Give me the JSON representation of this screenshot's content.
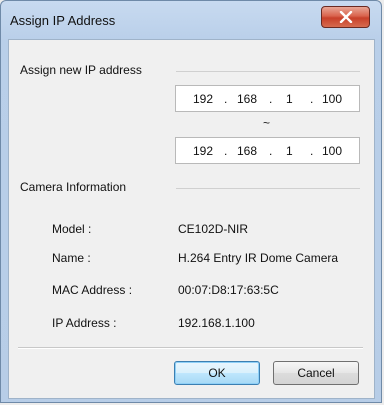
{
  "window": {
    "title": "Assign IP Address"
  },
  "assign_group": {
    "label": "Assign new IP address",
    "start_ip": [
      "192",
      "168",
      "1",
      "100"
    ],
    "range_separator": "~",
    "end_ip": [
      "192",
      "168",
      "1",
      "100"
    ],
    "dot": "."
  },
  "camera_info": {
    "label": "Camera Information",
    "model_label": "Model :",
    "model_value": "CE102D-NIR",
    "name_label": "Name :",
    "name_value": "H.264 Entry IR Dome Camera",
    "mac_label": "MAC Address :",
    "mac_value": "00:07:D8:17:63:5C",
    "ip_label": "IP Address :",
    "ip_value": "192.168.1.100"
  },
  "buttons": {
    "ok": "OK",
    "cancel": "Cancel"
  },
  "icons": {
    "close": "close-icon"
  },
  "colors": {
    "close_button": "#c8402a",
    "frame": "#b9cfe9",
    "client": "#f0f0f0"
  }
}
